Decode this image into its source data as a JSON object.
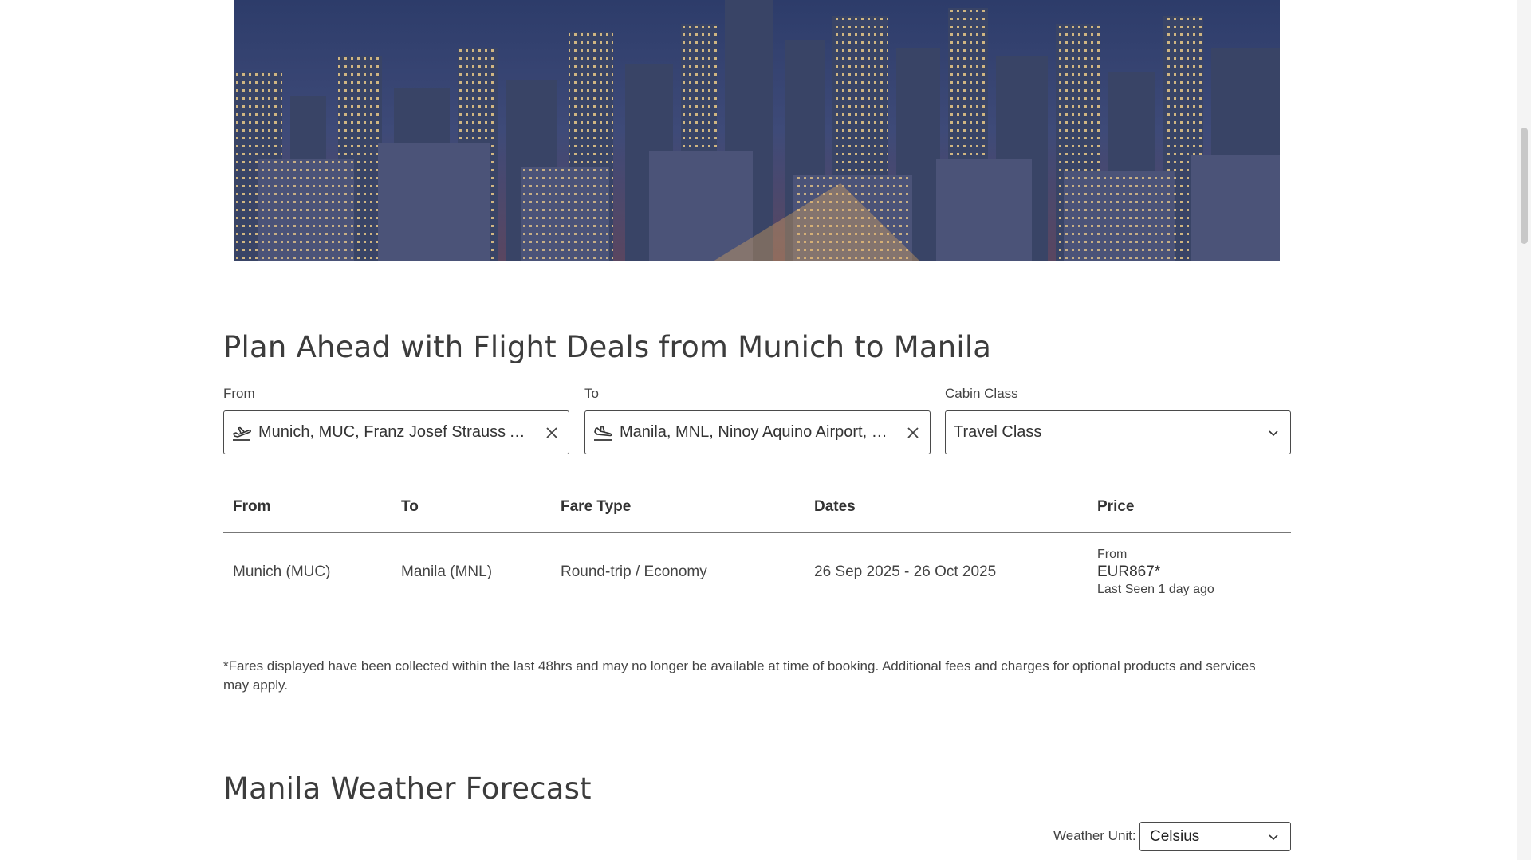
{
  "deals": {
    "title": "Plan Ahead with Flight Deals from Munich to Manila",
    "from_label": "From",
    "from_value": "Munich, MUC, Franz Josef Strauss Airport...",
    "to_label": "To",
    "to_value": "Manila, MNL, Ninoy Aquino Airport, Philip...",
    "cabin_label": "Cabin Class",
    "cabin_value": "Travel Class",
    "table": {
      "headers": [
        "From",
        "To",
        "Fare Type",
        "Dates",
        "Price"
      ],
      "rows": [
        {
          "from": "Munich (MUC)",
          "to": "Manila (MNL)",
          "fare_type": "Round-trip / Economy",
          "dates": "26 Sep 2025 - 26 Oct 2025",
          "price_prefix": "From",
          "price": "EUR867*",
          "last_seen": "Last Seen 1 day ago"
        }
      ]
    },
    "disclaimer": "*Fares displayed have been collected within the last 48hrs and may no longer be available at time of booking. Additional fees and charges for optional products and services may apply."
  },
  "weather": {
    "title": "Manila Weather Forecast",
    "unit_label": "Weather Unit:",
    "unit_value": "Celsius"
  },
  "icons": {
    "departure": "plane-departure-icon",
    "arrival": "plane-arrival-icon",
    "clear": "close-icon",
    "dropdown": "chevron-down-icon"
  }
}
